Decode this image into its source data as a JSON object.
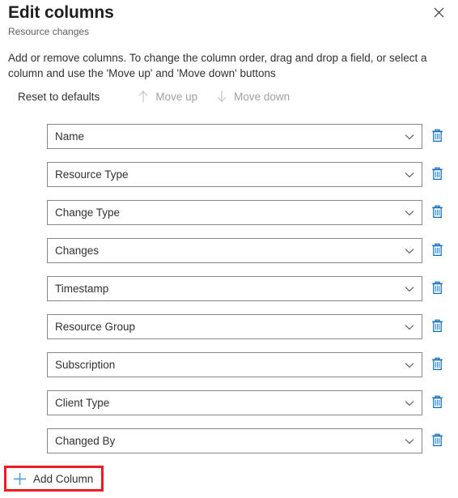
{
  "header": {
    "title": "Edit columns",
    "subtitle": "Resource changes",
    "close_icon": "close-icon"
  },
  "description": "Add or remove columns. To change the column order, drag and drop a field, or select a column and use the 'Move up' and 'Move down' buttons",
  "commandbar": {
    "reset": {
      "label": "Reset to defaults",
      "disabled": false
    },
    "move_up": {
      "label": "Move up",
      "icon": "arrow-up-icon",
      "disabled": true
    },
    "move_down": {
      "label": "Move down",
      "icon": "arrow-down-icon",
      "disabled": true
    }
  },
  "columns": [
    {
      "label": "Name",
      "delete_icon": "trash-icon",
      "chevron_icon": "chevron-down-icon"
    },
    {
      "label": "Resource Type",
      "delete_icon": "trash-icon",
      "chevron_icon": "chevron-down-icon"
    },
    {
      "label": "Change Type",
      "delete_icon": "trash-icon",
      "chevron_icon": "chevron-down-icon"
    },
    {
      "label": "Changes",
      "delete_icon": "trash-icon",
      "chevron_icon": "chevron-down-icon"
    },
    {
      "label": "Timestamp",
      "delete_icon": "trash-icon",
      "chevron_icon": "chevron-down-icon"
    },
    {
      "label": "Resource Group",
      "delete_icon": "trash-icon",
      "chevron_icon": "chevron-down-icon"
    },
    {
      "label": "Subscription",
      "delete_icon": "trash-icon",
      "chevron_icon": "chevron-down-icon"
    },
    {
      "label": "Client Type",
      "delete_icon": "trash-icon",
      "chevron_icon": "chevron-down-icon"
    },
    {
      "label": "Changed By",
      "delete_icon": "trash-icon",
      "chevron_icon": "chevron-down-icon"
    }
  ],
  "add_column": {
    "label": "Add Column",
    "icon": "plus-icon",
    "highlight_color": "#ec1c24"
  },
  "colors": {
    "accent_blue": "#0078d4",
    "icon_blue": "#5ba3e0",
    "text": "#323130",
    "muted_text": "#605e5c",
    "disabled_text": "#a19f9d",
    "border": "#8a8886",
    "annotation_red": "#ec1c24"
  }
}
